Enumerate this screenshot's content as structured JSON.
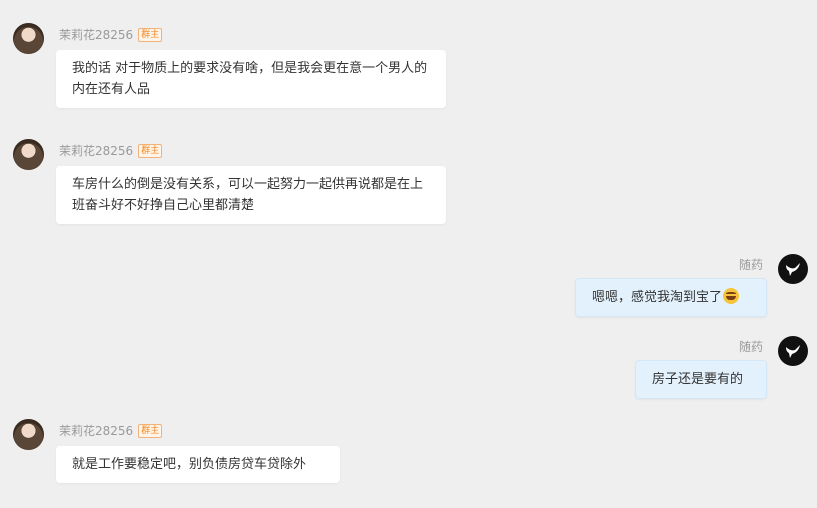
{
  "messages": [
    {
      "sender": "茉莉花28256",
      "badge": "群主",
      "text": "我的话 对于物质上的要求没有啥，但是我会更在意一个男人的内在还有人品"
    },
    {
      "sender": "茉莉花28256",
      "badge": "群主",
      "text": "车房什么的倒是没有关系，可以一起努力一起供再说都是在上班奋斗好不好挣自己心里都清楚"
    },
    {
      "sender": "随药",
      "text": "嗯嗯，感觉我淘到宝了",
      "emoji": "grinning-face-emoji"
    },
    {
      "sender": "随药",
      "text": "房子还是要有的"
    },
    {
      "sender": "茉莉花28256",
      "badge": "群主",
      "text": "就是工作要稳定吧，别负债房贷车贷除外"
    }
  ]
}
